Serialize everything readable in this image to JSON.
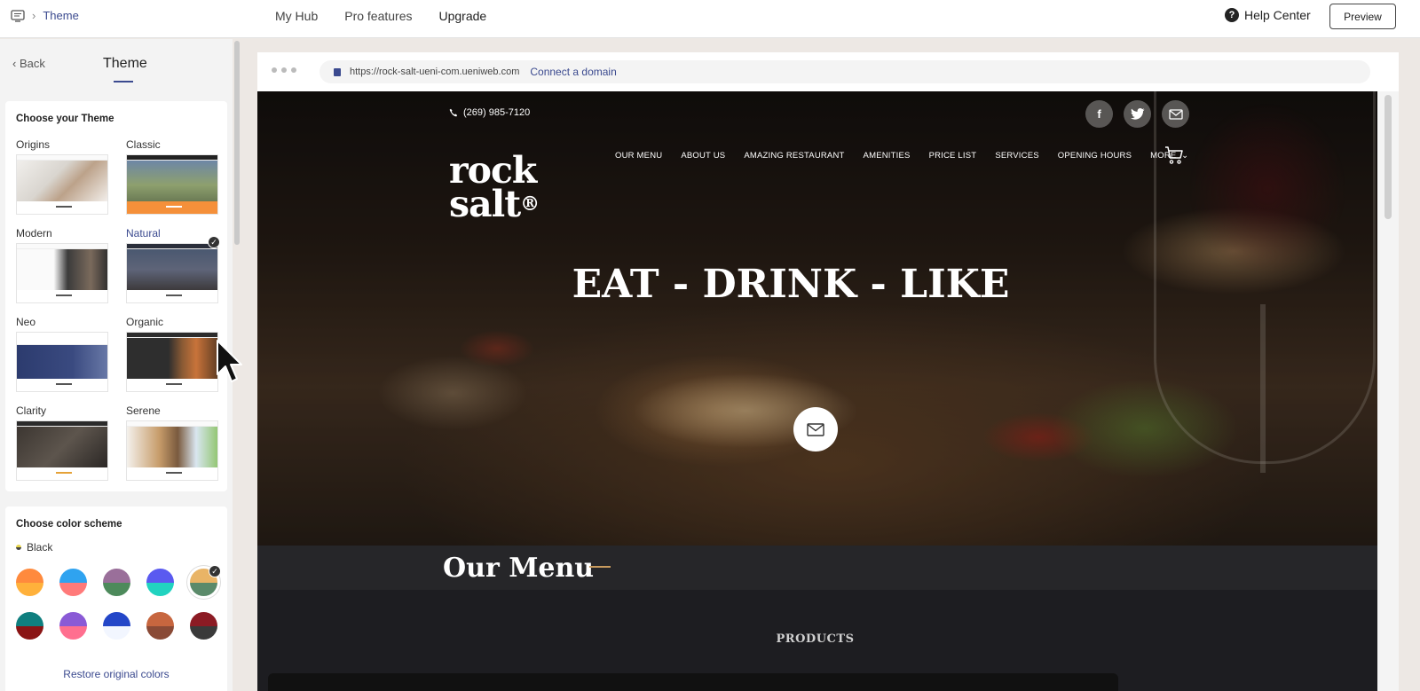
{
  "topbar": {
    "breadcrumb_icon": "monitor-icon",
    "breadcrumb_current": "Theme",
    "nav": [
      "My Hub",
      "Pro features",
      "Upgrade"
    ],
    "help_label": "Help Center",
    "preview_label": "Preview"
  },
  "sidebar": {
    "back_label": "Back",
    "title": "Theme",
    "theme_section_title": "Choose your Theme",
    "themes": [
      {
        "name": "Origins",
        "selected": false
      },
      {
        "name": "Classic",
        "selected": false
      },
      {
        "name": "Modern",
        "selected": false
      },
      {
        "name": "Natural",
        "selected": true
      },
      {
        "name": "Neo",
        "selected": false
      },
      {
        "name": "Organic",
        "selected": false
      },
      {
        "name": "Clarity",
        "selected": false
      },
      {
        "name": "Serene",
        "selected": false
      }
    ],
    "color_section_title": "Choose color scheme",
    "current_scheme": "Black",
    "swatches": [
      {
        "top": "#ff8a3d",
        "bottom": "#ffb13b"
      },
      {
        "top": "#2fa3f0",
        "bottom": "#ff7a7a"
      },
      {
        "top": "#9a6f9a",
        "bottom": "#4d8a5b"
      },
      {
        "top": "#5a5af0",
        "bottom": "#21d3c0"
      },
      {
        "top": "#e9b466",
        "bottom": "#5b8a6a",
        "selected": true
      },
      {
        "top": "#0f7f7f",
        "bottom": "#8a1414"
      },
      {
        "top": "#8a5ad6",
        "bottom": "#ff6f8f"
      },
      {
        "top": "#2346c8",
        "bottom": "#f2f6ff"
      },
      {
        "top": "#c7663f",
        "bottom": "#8a4a36"
      },
      {
        "top": "#8c1b24",
        "bottom": "#3a3a3a"
      }
    ],
    "restore_label": "Restore original colors"
  },
  "browser": {
    "url": "https://rock-salt-ueni-com.ueniweb.com",
    "connect_label": "Connect a domain"
  },
  "site": {
    "phone": "(269) 985-7120",
    "logo_line1": "rock",
    "logo_line2": "salt",
    "logo_mark": "®",
    "nav": [
      "OUR MENU",
      "ABOUT US",
      "AMAZING RESTAURANT",
      "AMENITIES",
      "PRICE LIST",
      "SERVICES",
      "OPENING HOURS",
      "MORE"
    ],
    "headline": "EAT - DRINK - LIKE",
    "menu_title": "Our Menu",
    "products_label": "PRODUCTS"
  }
}
